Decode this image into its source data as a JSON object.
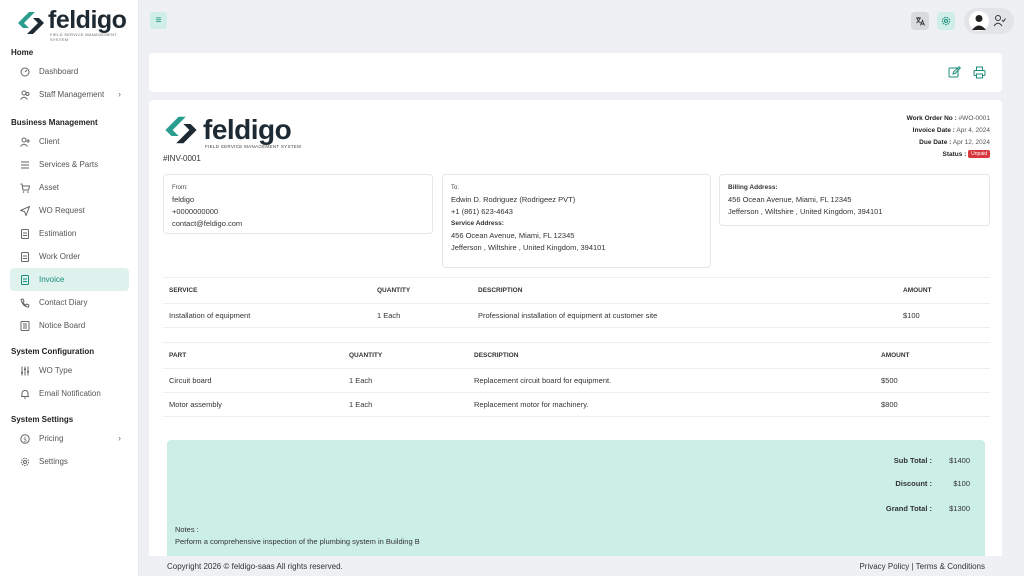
{
  "brand": {
    "name": "feldigo",
    "tagline": "Field Service Management System"
  },
  "sidebar": {
    "sections": [
      {
        "title": "Home",
        "items": [
          {
            "label": "Dashboard",
            "icon": "dashboard-icon"
          },
          {
            "label": "Staff Management",
            "icon": "users-icon",
            "has_submenu": true
          }
        ]
      },
      {
        "title": "Business Management",
        "items": [
          {
            "label": "Client",
            "icon": "user-plus-icon"
          },
          {
            "label": "Services & Parts",
            "icon": "list-icon"
          },
          {
            "label": "Asset",
            "icon": "cart-icon"
          },
          {
            "label": "WO Request",
            "icon": "send-icon"
          },
          {
            "label": "Estimation",
            "icon": "document-icon"
          },
          {
            "label": "Work Order",
            "icon": "document-icon"
          },
          {
            "label": "Invoice",
            "icon": "invoice-icon",
            "active": true
          },
          {
            "label": "Contact Diary",
            "icon": "phone-icon"
          },
          {
            "label": "Notice Board",
            "icon": "board-icon"
          }
        ]
      },
      {
        "title": "System Configuration",
        "items": [
          {
            "label": "WO Type",
            "icon": "sliders-icon"
          },
          {
            "label": "Email Notification",
            "icon": "bell-icon"
          }
        ]
      },
      {
        "title": "System Settings",
        "items": [
          {
            "label": "Pricing",
            "icon": "pricing-icon",
            "has_submenu": true
          },
          {
            "label": "Settings",
            "icon": "gear-icon"
          }
        ]
      }
    ]
  },
  "invoice": {
    "number": "#INV-0001",
    "meta": {
      "work_order_label": "Work Order No :",
      "work_order_value": "#WO-0001",
      "invoice_date_label": "Invoice Date :",
      "invoice_date_value": "Apr 4, 2024",
      "due_date_label": "Due Date :",
      "due_date_value": "Apr 12, 2024",
      "status_label": "Status :",
      "status_value": "Unpaid"
    },
    "from": {
      "label": "From:",
      "name": "feldigo",
      "phone": "+0000000000",
      "email": "contact@feldigo.com"
    },
    "to": {
      "label": "To:",
      "name": "Edwin D. Rodriguez (Rodrigeez PVT)",
      "phone": "+1 (861) 623-4643",
      "service_label": "Service Address:",
      "service_line1": "456 Ocean Avenue, Miami, FL 12345",
      "service_line2": "Jefferson , Wiltshire , United Kingdom, 394101"
    },
    "billing": {
      "label": "Billing Address:",
      "line1": "456 Ocean Avenue, Miami, FL 12345",
      "line2": "Jefferson , Wiltshire , United Kingdom, 394101"
    },
    "services_table": {
      "headers": [
        "SERVICE",
        "QUANTITY",
        "DESCRIPTION",
        "AMOUNT"
      ],
      "rows": [
        [
          "Installation of equipment",
          "1 Each",
          "Professional installation of equipment at customer site",
          "$100"
        ]
      ]
    },
    "parts_table": {
      "headers": [
        "PART",
        "QUANTITY",
        "DESCRIPTION",
        "AMOUNT"
      ],
      "rows": [
        [
          "Circuit board",
          "1 Each",
          "Replacement circuit board for equipment.",
          "$500"
        ],
        [
          "Motor assembly",
          "1 Each",
          "Replacement motor for machinery.",
          "$800"
        ]
      ]
    },
    "totals": {
      "subtotal_label": "Sub Total :",
      "subtotal_value": "$1400",
      "discount_label": "Discount :",
      "discount_value": "$100",
      "grand_label": "Grand Total :",
      "grand_value": "$1300"
    },
    "notes": {
      "label": "Notes :",
      "text": "Perform a comprehensive inspection of the plumbing system in Building B"
    }
  },
  "footer": {
    "copyright": "Copyright 2026 © feldigo-saas All rights reserved.",
    "privacy": "Privacy Policy",
    "separator": "|",
    "terms": "Terms & Conditions"
  },
  "colors": {
    "accent": "#1a8d7b",
    "accent_light": "#cbeee6",
    "danger": "#d9383f"
  }
}
